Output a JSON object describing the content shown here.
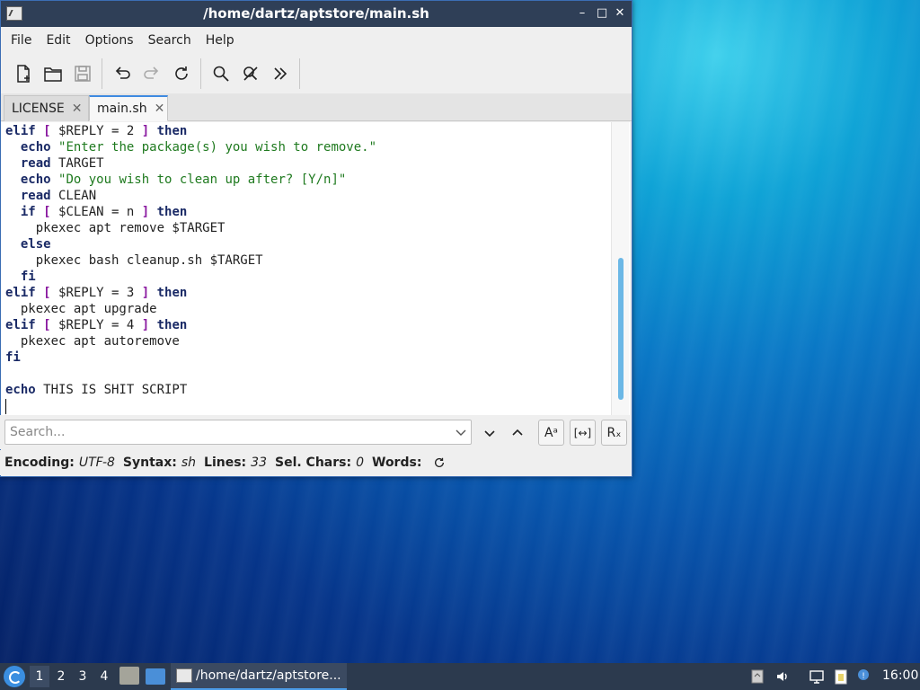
{
  "window": {
    "title": "/home/dartz/aptstore/main.sh",
    "controls": {
      "minimize": "–",
      "maximize": "□",
      "close": "✕"
    }
  },
  "menubar": {
    "items": [
      "File",
      "Edit",
      "Options",
      "Search",
      "Help"
    ]
  },
  "toolbar": {
    "buttons": [
      "new-file-icon",
      "open-folder-icon",
      "save-icon",
      "undo-icon",
      "redo-icon",
      "reload-icon",
      "find-icon",
      "find-replace-icon",
      "more-icon"
    ]
  },
  "tabs": [
    {
      "label": "LICENSE",
      "close": "✕"
    },
    {
      "label": "main.sh",
      "close": "✕"
    }
  ],
  "editor": {
    "lines": [
      "elif [ $REPLY = 2 ] then",
      "  echo \"Enter the package(s) you wish to remove.\"",
      "  read TARGET",
      "  echo \"Do you wish to clean up after? [Y/n]\"",
      "  read CLEAN",
      "  if [ $CLEAN = n ] then",
      "    pkexec apt remove $TARGET",
      "  else",
      "    pkexec bash cleanup.sh $TARGET",
      "  fi",
      "elif [ $REPLY = 3 ] then",
      "  pkexec apt upgrade",
      "elif [ $REPLY = 4 ] then",
      "  pkexec apt autoremove",
      "fi",
      "",
      "echo THIS IS SHIT SCRIPT",
      ""
    ]
  },
  "search": {
    "placeholder": "Search...",
    "match_case": "Aᵃ",
    "whole_word": "[↔]",
    "regex": "Rₓ"
  },
  "status": {
    "encoding_label": "Encoding:",
    "encoding_value": "UTF-8",
    "syntax_label": "Syntax:",
    "syntax_value": "sh",
    "lines_label": "Lines:",
    "lines_value": "33",
    "sel_label": "Sel. Chars:",
    "sel_value": "0",
    "words_label": "Words:"
  },
  "taskbar": {
    "workspaces": [
      "1",
      "2",
      "3",
      "4"
    ],
    "task_title": "/home/dartz/aptstore...",
    "clock": "16:00"
  },
  "colors": {
    "titlebar": "#2f3f57",
    "accent": "#3f8ae0",
    "keyword": "#1a2a66",
    "bracket": "#8a1aa0",
    "string": "#1f7a1f"
  }
}
